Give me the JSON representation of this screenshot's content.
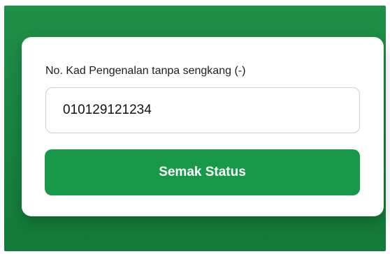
{
  "form": {
    "ic_label": "No. Kad Pengenalan tanpa sengkang (-)",
    "ic_value": "010129121234",
    "submit_label": "Semak Status"
  },
  "colors": {
    "background_green": "#1a8a43",
    "button_green": "#18994a",
    "card_white": "#ffffff"
  }
}
